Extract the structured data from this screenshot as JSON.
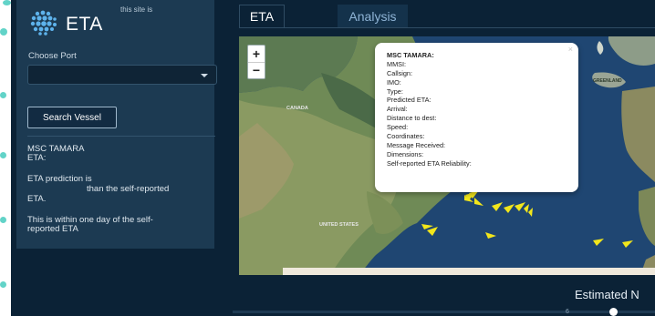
{
  "app": {
    "title": "ETA",
    "caption": "this site is",
    "logo_icon": "globe-dots-icon"
  },
  "sidebar": {
    "choose_port_label": "Choose Port",
    "port_select_value": "",
    "search_button": "Search Vessel",
    "vessel_name": "MSC TAMARA",
    "eta_label": "ETA:",
    "prediction_line1": "ETA prediction is",
    "prediction_line2": "than the self-reported",
    "prediction_line3": "ETA.",
    "within_line1": "This is within one day of the self-",
    "within_line2": "reported ETA"
  },
  "tabs": [
    {
      "label": "ETA",
      "active": true
    },
    {
      "label": "Analysis",
      "active": false
    }
  ],
  "map": {
    "zoom_in": "+",
    "zoom_out": "−",
    "labels": {
      "canada": "CANADA",
      "united_states": "UNITED STATES",
      "greenland": "GREENLAND"
    },
    "vessel_marker_color": "#f2e61b",
    "vessel_marker_icon": "ship-arrow-icon",
    "popup": {
      "close": "×",
      "title": "MSC TAMARA:",
      "fields": [
        "MMSI:",
        "Callsign:",
        "IMO:",
        "Type:",
        "Predicted ETA:",
        "Arrival:",
        "Distance to dest:",
        "Speed:",
        "Coordinates:",
        "Message Received:",
        "Dimensions:",
        "Self-reported ETA Reliability:"
      ]
    }
  },
  "bottom": {
    "estimated_label": "Estimated N",
    "slider_min": "6"
  },
  "colors": {
    "app_bg": "#0b2236",
    "sidebar_bg": "#1c3a52",
    "accent_dots": "#2ec4b6",
    "analysis_tab_text": "#8fb4d6"
  }
}
